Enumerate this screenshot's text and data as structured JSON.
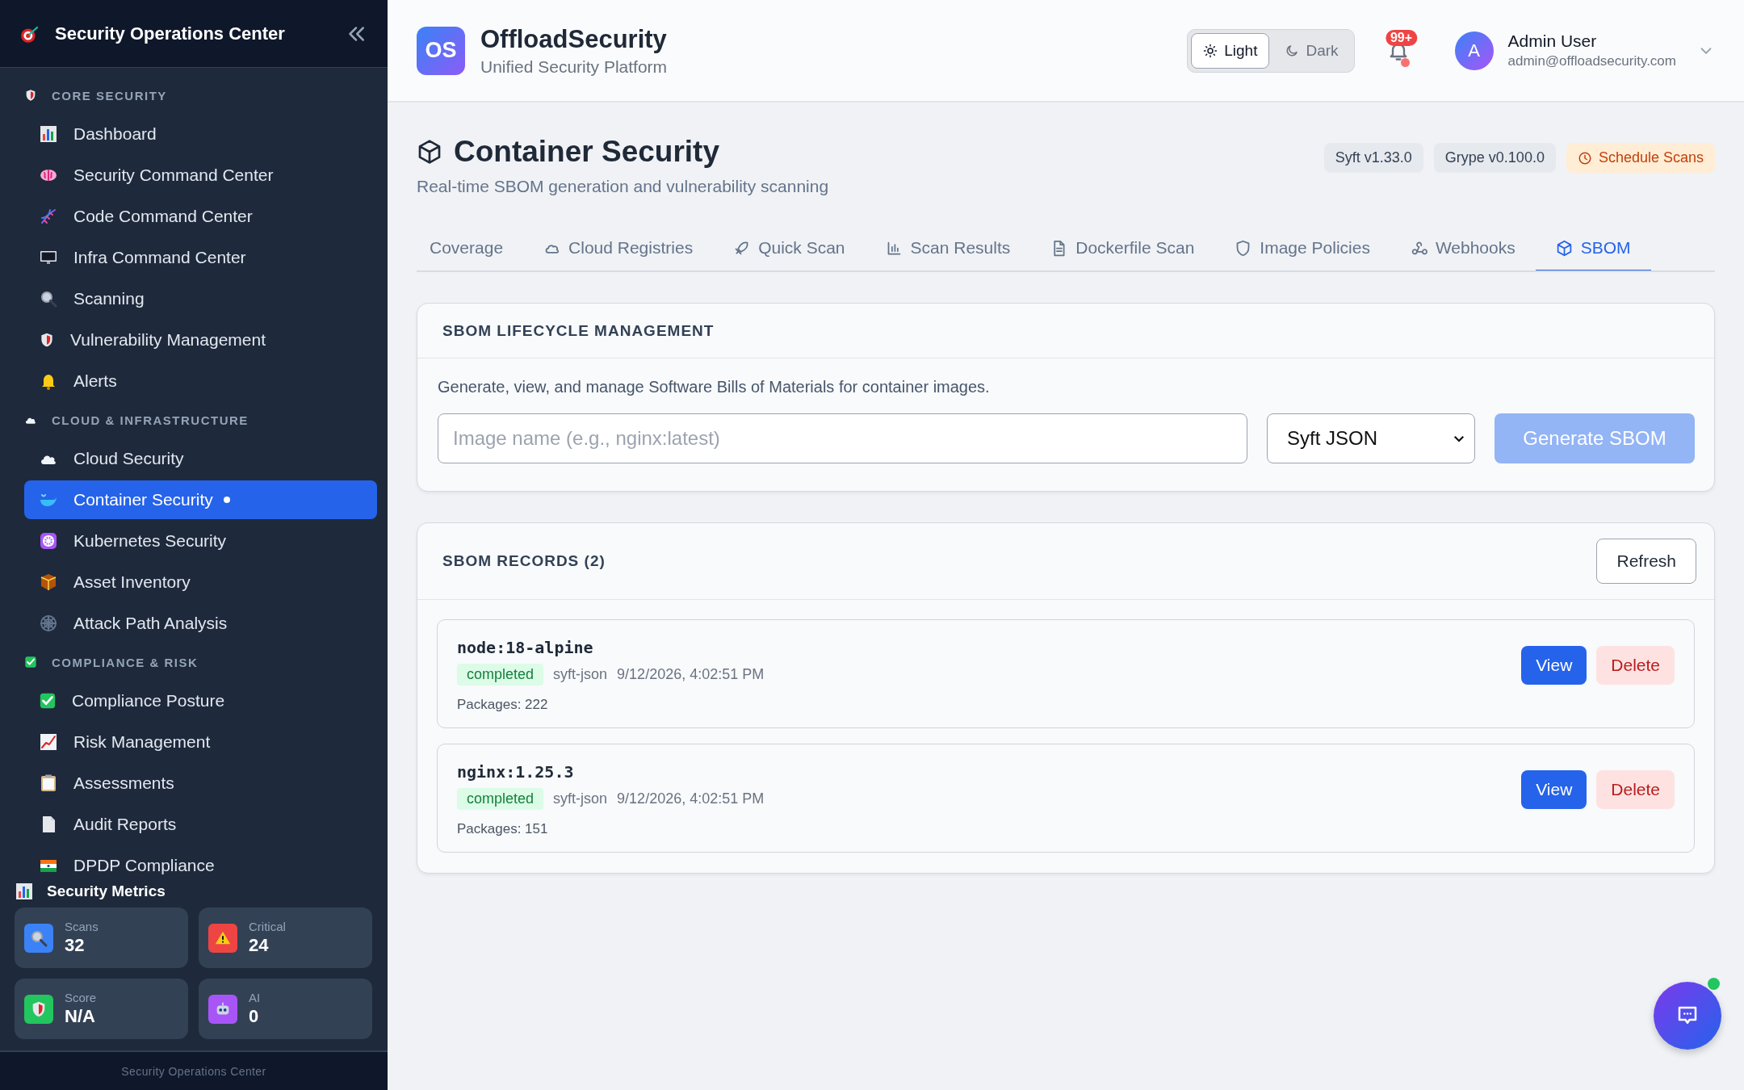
{
  "sidebar": {
    "title": "Security Operations Center",
    "sections": [
      {
        "label": "CORE SECURITY",
        "items": [
          {
            "label": "Dashboard",
            "selected": false
          },
          {
            "label": "Security Command Center",
            "selected": false
          },
          {
            "label": "Code Command Center",
            "selected": false
          },
          {
            "label": "Infra Command Center",
            "selected": false
          },
          {
            "label": "Scanning",
            "selected": false
          },
          {
            "label": "Vulnerability Management",
            "selected": false
          },
          {
            "label": "Alerts",
            "selected": false
          }
        ]
      },
      {
        "label": "CLOUD & INFRASTRUCTURE",
        "items": [
          {
            "label": "Cloud Security",
            "selected": false
          },
          {
            "label": "Container Security",
            "selected": true
          },
          {
            "label": "Kubernetes Security",
            "selected": false
          },
          {
            "label": "Asset Inventory",
            "selected": false
          },
          {
            "label": "Attack Path Analysis",
            "selected": false
          }
        ]
      },
      {
        "label": "COMPLIANCE & RISK",
        "items": [
          {
            "label": "Compliance Posture",
            "selected": false
          },
          {
            "label": "Risk Management",
            "selected": false
          },
          {
            "label": "Assessments",
            "selected": false
          },
          {
            "label": "Audit Reports",
            "selected": false
          },
          {
            "label": "DPDP Compliance",
            "selected": false
          }
        ]
      }
    ],
    "metrics": {
      "title": "Security Metrics",
      "cards": [
        {
          "label": "Scans",
          "value": "32"
        },
        {
          "label": "Critical",
          "value": "24"
        },
        {
          "label": "Score",
          "value": "N/A"
        },
        {
          "label": "AI",
          "value": "0"
        }
      ]
    },
    "footer": "Security Operations Center"
  },
  "header": {
    "logo": "OS",
    "brand": "OffloadSecurity",
    "tagline": "Unified Security Platform",
    "theme": [
      {
        "label": "Light",
        "selected": true
      },
      {
        "label": "Dark",
        "selected": false
      }
    ],
    "notifications": "99+",
    "user": {
      "avatar": "A",
      "name": "Admin User",
      "email": "admin@offloadsecurity.com"
    }
  },
  "page": {
    "title": "Container Security",
    "subtitle": "Real-time SBOM generation and vulnerability scanning",
    "badges": [
      {
        "label": "Syft v1.33.0",
        "kind": "version"
      },
      {
        "label": "Grype v0.100.0",
        "kind": "version"
      },
      {
        "label": "Schedule Scans",
        "kind": "schedule"
      }
    ],
    "tabs": [
      {
        "label": "Coverage",
        "selected": false
      },
      {
        "label": "Cloud Registries",
        "selected": false
      },
      {
        "label": "Quick Scan",
        "selected": false
      },
      {
        "label": "Scan Results",
        "selected": false
      },
      {
        "label": "Dockerfile Scan",
        "selected": false
      },
      {
        "label": "Image Policies",
        "selected": false
      },
      {
        "label": "Webhooks",
        "selected": false
      },
      {
        "label": "SBOM",
        "selected": true
      }
    ]
  },
  "lifecycle": {
    "title": "SBOM LIFECYCLE MANAGEMENT",
    "description": "Generate, view, and manage Software Bills of Materials for container images.",
    "image_field": {
      "placeholder": "Image name (e.g., nginx:latest)"
    },
    "format_select": {
      "value": "Syft JSON"
    },
    "generate_button": {
      "label": "Generate SBOM",
      "disabled": true
    }
  },
  "records": {
    "title": "SBOM RECORDS (2)",
    "refresh": "Refresh",
    "items": [
      {
        "name": "node:18-alpine",
        "status": "completed",
        "format": "syft-json",
        "date": "9/12/2026, 4:02:51 PM",
        "packages": "Packages: 222",
        "view": "View",
        "delete": "Delete"
      },
      {
        "name": "nginx:1.25.3",
        "status": "completed",
        "format": "syft-json",
        "date": "9/12/2026, 4:02:51 PM",
        "packages": "Packages: 151",
        "view": "View",
        "delete": "Delete"
      }
    ]
  }
}
